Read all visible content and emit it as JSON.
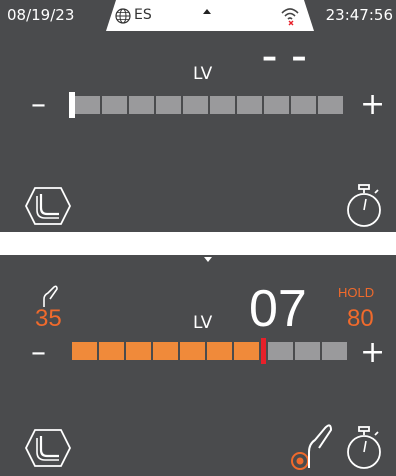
{
  "status_bar": {
    "date": "08/19/23",
    "language": "ES",
    "time": "23:47:56",
    "icons": [
      "globe-icon",
      "caret-up-icon",
      "wifi-off-icon"
    ]
  },
  "screen_idle": {
    "level_label": "LV",
    "level_value": "– –",
    "minus": "–",
    "plus": "+",
    "level_fill": 0,
    "segments_total": 10,
    "icons": [
      "seat-recline-icon",
      "stopwatch-icon"
    ]
  },
  "screen_active": {
    "level_label": "LV",
    "level_value": "07",
    "minus": "–",
    "plus": "+",
    "left_value": "35",
    "hold_label": "HOLD",
    "hold_value": "80",
    "segments_total": 10,
    "segments_on": 7,
    "icons": [
      "caret-down-icon",
      "probe-icon",
      "seat-recline-icon",
      "target-probe-icon",
      "stopwatch-icon"
    ],
    "colors": {
      "accent": "#f08a3a",
      "indicator": "#e8202a",
      "text_accent": "#f06a2c"
    }
  },
  "colors": {
    "panel_bg": "#4a4b4d",
    "segment_off": "#9a9a9c"
  }
}
